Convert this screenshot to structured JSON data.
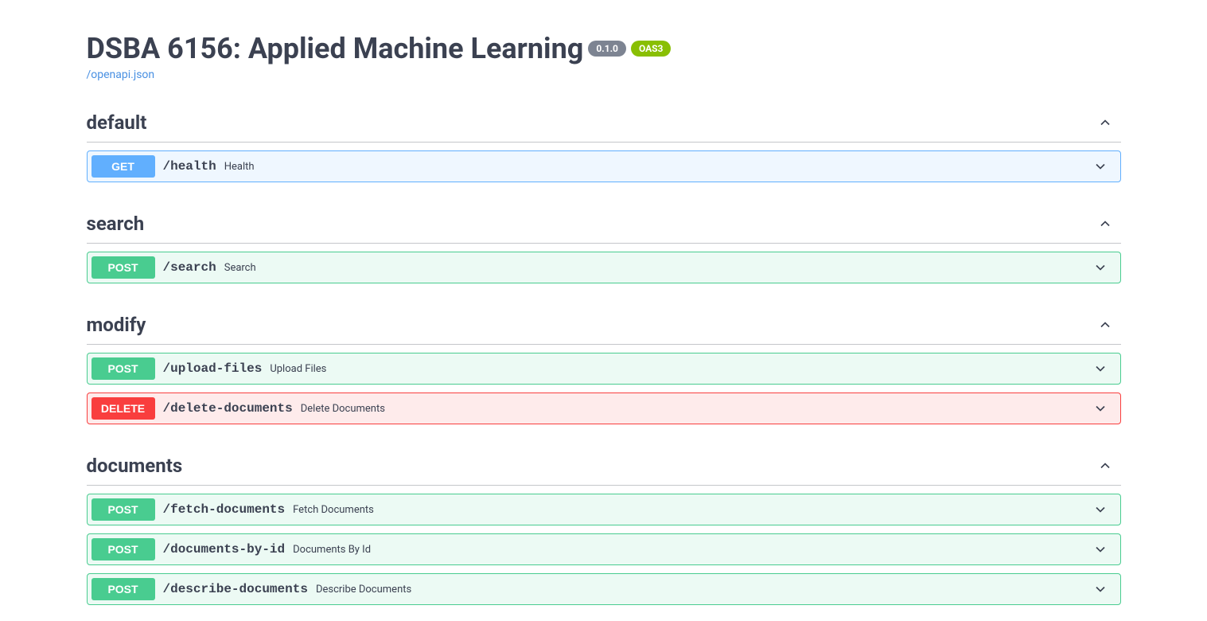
{
  "header": {
    "title": "DSBA 6156: Applied Machine Learning",
    "version": "0.1.0",
    "oas": "OAS3",
    "spec_link": "/openapi.json"
  },
  "tags": [
    {
      "name": "default",
      "operations": [
        {
          "method": "GET",
          "methodClass": "get",
          "path": "/health",
          "summary": "Health"
        }
      ]
    },
    {
      "name": "search",
      "operations": [
        {
          "method": "POST",
          "methodClass": "post",
          "path": "/search",
          "summary": "Search"
        }
      ]
    },
    {
      "name": "modify",
      "operations": [
        {
          "method": "POST",
          "methodClass": "post",
          "path": "/upload-files",
          "summary": "Upload Files"
        },
        {
          "method": "DELETE",
          "methodClass": "delete",
          "path": "/delete-documents",
          "summary": "Delete Documents"
        }
      ]
    },
    {
      "name": "documents",
      "operations": [
        {
          "method": "POST",
          "methodClass": "post",
          "path": "/fetch-documents",
          "summary": "Fetch Documents"
        },
        {
          "method": "POST",
          "methodClass": "post",
          "path": "/documents-by-id",
          "summary": "Documents By Id"
        },
        {
          "method": "POST",
          "methodClass": "post",
          "path": "/describe-documents",
          "summary": "Describe Documents"
        }
      ]
    }
  ]
}
